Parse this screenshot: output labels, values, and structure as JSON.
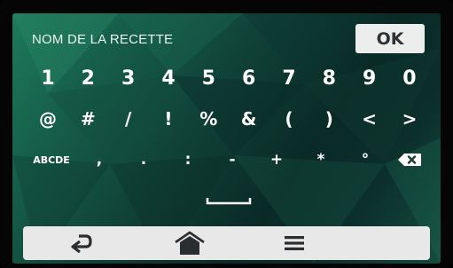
{
  "input": {
    "label": "NOM DE LA RECETTE"
  },
  "ok_button": {
    "label": "OK"
  },
  "keyboard": {
    "row1": [
      "1",
      "2",
      "3",
      "4",
      "5",
      "6",
      "7",
      "8",
      "9",
      "0"
    ],
    "row2": [
      "@",
      "#",
      "/",
      "!",
      "%",
      "&",
      "(",
      ")",
      "<",
      ">"
    ],
    "row3": [
      "ABCDE",
      ",",
      ".",
      ":",
      "-",
      "+",
      "*",
      "°"
    ],
    "backspace_icon": "backspace-icon",
    "space_icon": "space-bar-icon"
  },
  "nav": {
    "back_icon": "back-arrow-icon",
    "home_icon": "home-icon",
    "menu_icon": "menu-icon"
  },
  "colors": {
    "background_start": "#1d7a5a",
    "background_end": "#0a2a26",
    "key_text": "#ffffff",
    "ok_button_bg": "#eceeee",
    "bottom_bar_bg": "#e8e8e8",
    "icon_dark": "#2a2e31"
  }
}
